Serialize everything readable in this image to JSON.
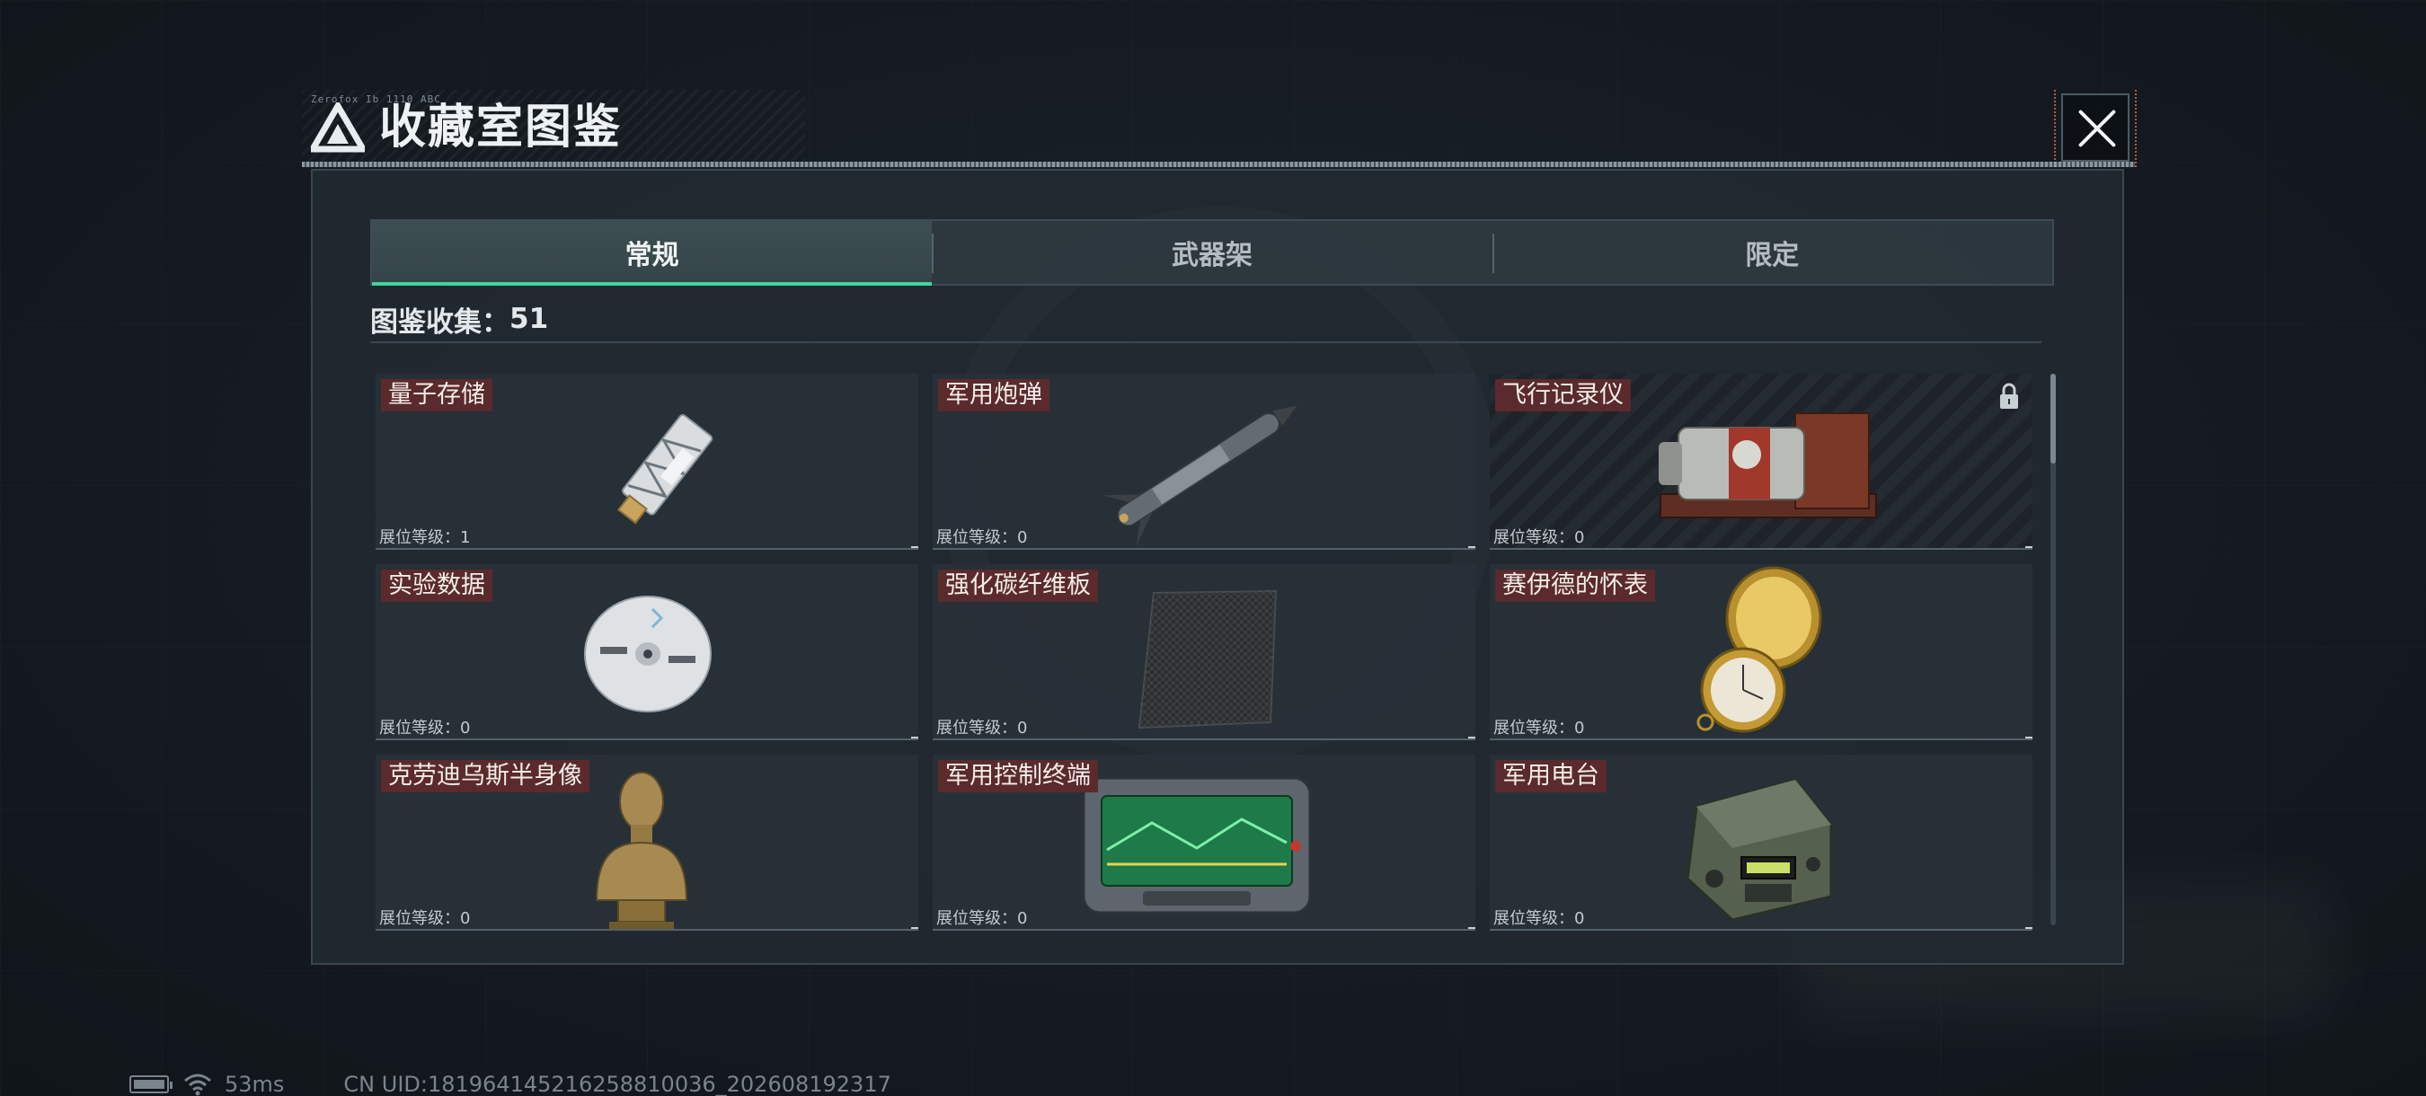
{
  "header": {
    "code_text": "Zerofox Ib 1110 ABC",
    "title": "收藏室图鉴"
  },
  "tabs": [
    {
      "label": "常规",
      "active": true
    },
    {
      "label": "武器架",
      "active": false
    },
    {
      "label": "限定",
      "active": false
    }
  ],
  "collection": {
    "label": "图鉴收集：",
    "count": "51"
  },
  "level_label": "展位等级：",
  "cards": [
    {
      "name": "量子存储",
      "level": "1",
      "locked": false,
      "icon": "usb-drive-icon"
    },
    {
      "name": "军用炮弹",
      "level": "0",
      "locked": false,
      "icon": "missile-icon"
    },
    {
      "name": "飞行记录仪",
      "level": "0",
      "locked": true,
      "icon": "flight-recorder-icon"
    },
    {
      "name": "实验数据",
      "level": "0",
      "locked": false,
      "icon": "disc-icon"
    },
    {
      "name": "强化碳纤维板",
      "level": "0",
      "locked": false,
      "icon": "carbon-plate-icon"
    },
    {
      "name": "赛伊德的怀表",
      "level": "0",
      "locked": false,
      "icon": "pocket-watch-icon"
    },
    {
      "name": "克劳迪乌斯半身像",
      "level": "0",
      "locked": false,
      "icon": "bust-icon"
    },
    {
      "name": "军用控制终端",
      "level": "0",
      "locked": false,
      "icon": "control-terminal-icon"
    },
    {
      "name": "军用电台",
      "level": "0",
      "locked": false,
      "icon": "radio-icon"
    }
  ],
  "status_bar": {
    "ping": "53ms",
    "uid": "CN UID:181964145216258810036_202608192317"
  },
  "colors": {
    "accent": "#3fd49c",
    "name_tag": "#5a2a2c",
    "panel": "#222a32"
  }
}
